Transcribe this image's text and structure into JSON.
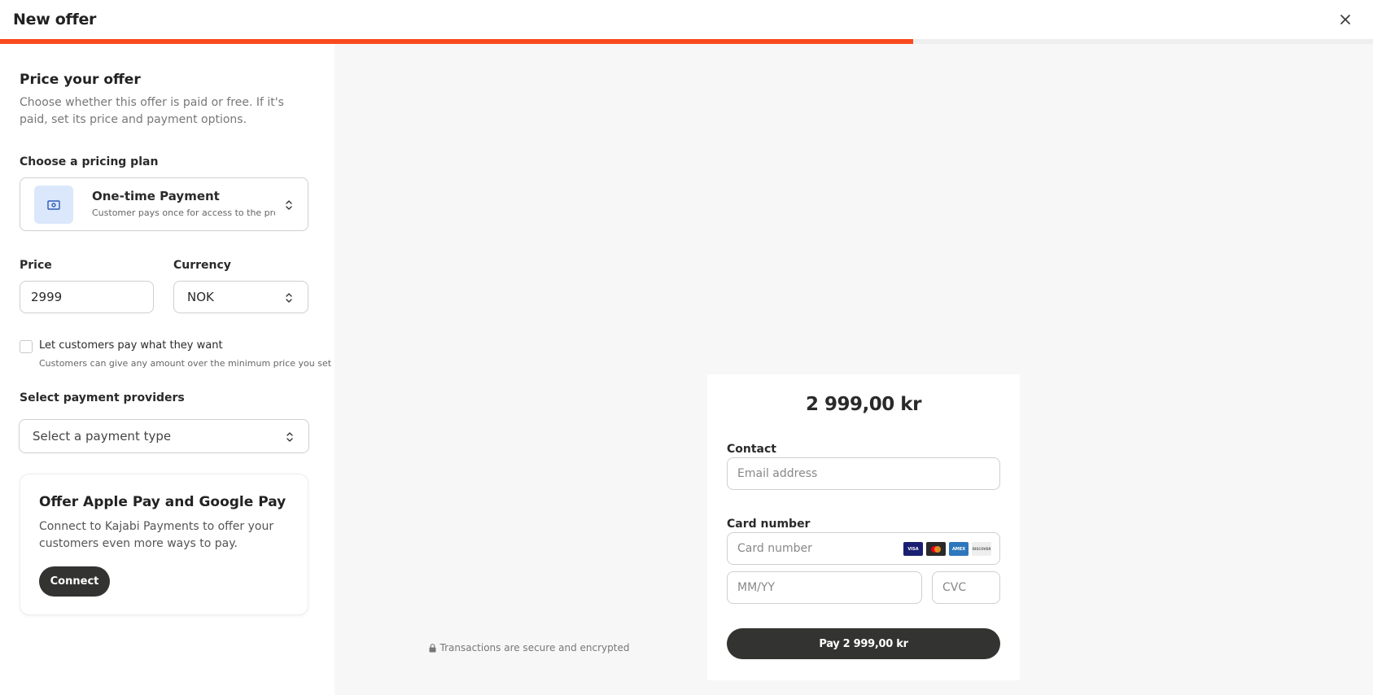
{
  "header": {
    "title": "New offer",
    "close_icon": "close-icon"
  },
  "progress": {
    "percent": 66.5,
    "accent_color": "#fa4a1f"
  },
  "left_panel": {
    "heading": "Price your offer",
    "description": "Choose whether this offer is paid or free. If it's paid, set its price and payment options.",
    "pricing_plan": {
      "label": "Choose a pricing plan",
      "selected_title": "One-time Payment",
      "selected_subtitle": "Customer pays once for access to the product",
      "icon": "cash-icon"
    },
    "price": {
      "label": "Price",
      "value": "2999"
    },
    "currency": {
      "label": "Currency",
      "value": "NOK"
    },
    "pay_what_you_want": {
      "label": "Let customers pay what they want",
      "sub": "Customers can give any amount over the minimum price you set",
      "checked": false
    },
    "payment_providers": {
      "label": "Select payment providers",
      "placeholder": "Select a payment type"
    },
    "promo_card": {
      "title": "Offer Apple Pay and Google Pay",
      "text": "Connect to Kajabi Payments to offer your customers even more ways to pay.",
      "button": "Connect"
    }
  },
  "checkout_preview": {
    "amount": "2 999,00 kr",
    "contact_label": "Contact",
    "email_placeholder": "Email address",
    "card_label": "Card number",
    "card_placeholder": "Card number",
    "expiry_placeholder": "MM/YY",
    "cvc_placeholder": "CVC",
    "card_brands": [
      "VISA",
      "MC",
      "AMEX",
      "DISCOVER"
    ],
    "pay_button": "Pay 2 999,00 kr",
    "secure_text": "Transactions are secure and encrypted"
  }
}
